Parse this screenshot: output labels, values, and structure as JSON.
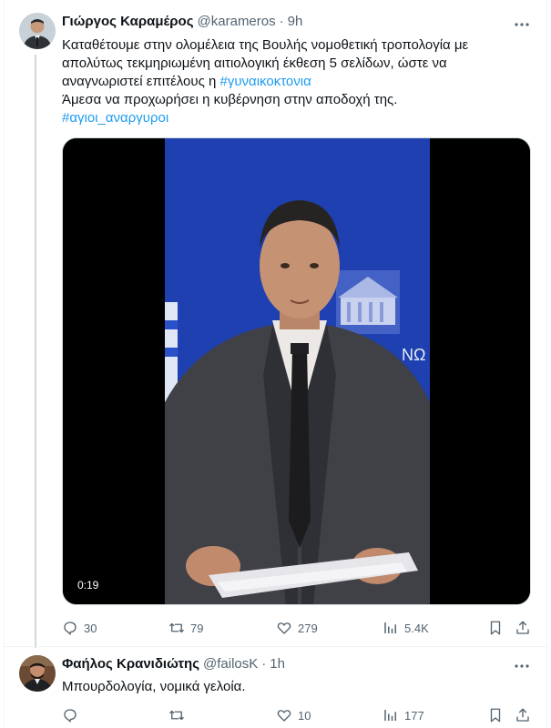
{
  "tweet1": {
    "author_name": "Γιώργος Καραμέρος",
    "handle": "@karameros",
    "separator": "·",
    "time": "9h",
    "text_line1": "Καταθέτουμε στην ολομέλεια της Βουλής νομοθετική τροπολογία με",
    "text_line2": "απολύτως τεκμηριωμένη αιτιολογική έκθεση 5 σελίδων, ώστε να",
    "text_line3_prefix": "αναγνωριστεί επιτέλους η ",
    "hashtag1": "#γυναικοκτονια",
    "text_line4": "Άμεσα να προχωρήσει η κυβέρνηση στην αποδοχή της.",
    "hashtag2": "#αγιοι_αναργυροι",
    "video": {
      "duration": "0:19",
      "backdrop_color": "#1e40b0",
      "overlay_text": "ΝΩ"
    },
    "actions": {
      "replies": "30",
      "reposts": "79",
      "likes": "279",
      "views": "5.4K"
    }
  },
  "tweet2": {
    "author_name": "Φαήλος Κρανιδιώτης",
    "handle": "@failosK",
    "separator": "·",
    "time": "1h",
    "text": "Μπουρδολογία, νομικά γελοία.",
    "actions": {
      "replies": "",
      "reposts": "",
      "likes": "10",
      "views": "177"
    }
  },
  "icons": [
    "reply-icon",
    "repost-icon",
    "like-icon",
    "views-icon",
    "bookmark-icon",
    "share-icon",
    "more-icon"
  ],
  "colors": {
    "accent": "#1d9bf0",
    "secondary_text": "#536471",
    "primary_text": "#0f1419"
  }
}
